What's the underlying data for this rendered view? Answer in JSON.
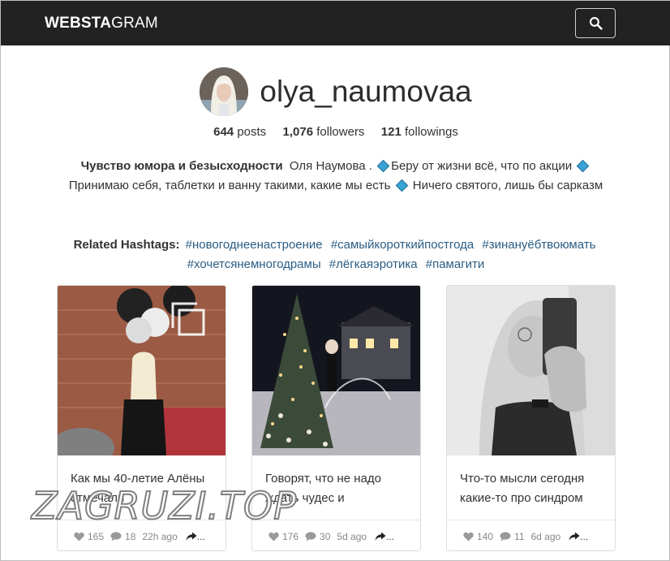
{
  "navbar": {
    "brand_bold": "WEBSTA",
    "brand_light": "GRAM",
    "search_icon": "search-icon"
  },
  "profile": {
    "username": "olya_naumovaa",
    "posts_count": "644",
    "posts_label": "posts",
    "followers_count": "1,076",
    "followers_label": "followers",
    "followings_count": "121",
    "followings_label": "followings",
    "bio_bold": "Чувство юмора и безысходности",
    "bio_part1": "Оля Наумова .",
    "bio_part2": "Беру от жизни всё, что по акции",
    "bio_part3": "Принимаю себя, таблетки и ванну такими, какие мы есть",
    "bio_part4": "Ничего святого, лишь бы сарказм"
  },
  "related": {
    "label": "Related Hashtags:",
    "tags": [
      "#новогоднеенастроение",
      "#самыйкороткийпостгода",
      "#зинануёбтвоюмать",
      "#хочетсянемногодрамы",
      "#лёгкаяэротика",
      "#памагити"
    ]
  },
  "posts": [
    {
      "caption": "Как мы 40-летие Алёны отмечали",
      "likes": "165",
      "comments": "18",
      "time": "22h ago",
      "more": "..."
    },
    {
      "caption": "Говорят, что не надо ждать чудес и",
      "likes": "176",
      "comments": "30",
      "time": "5d ago",
      "more": "..."
    },
    {
      "caption": "Что-то мысли сегодня какие-то про синдром",
      "likes": "140",
      "comments": "11",
      "time": "6d ago",
      "more": "..."
    }
  ],
  "watermark": "ZAGRUZI.TOP",
  "colors": {
    "navbar": "#222222",
    "link": "#2a5d84",
    "diamond": "#3aa3d6"
  }
}
